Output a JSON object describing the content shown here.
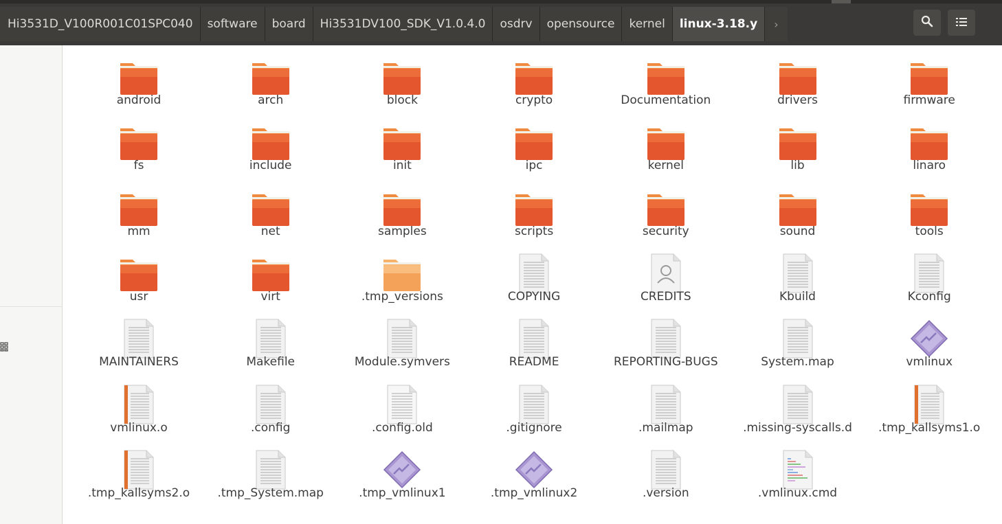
{
  "breadcrumb": [
    "Hi3531D_V100R001C01SPC040",
    "software",
    "board",
    "Hi3531DV100_SDK_V1.0.4.0",
    "osdrv",
    "opensource",
    "kernel",
    "linux-3.18.y"
  ],
  "more_glyph": "›",
  "toolbar": {
    "search_glyph": "🔍",
    "list_glyph": "☷",
    "grid_glyph": "⋮⋮"
  },
  "colors": {
    "folder": "#e4562e",
    "folder_light": "#f08a3e",
    "header_bg": "#3a3937",
    "exec": "#9b87c8"
  },
  "files": [
    {
      "name": "android",
      "kind": "folder"
    },
    {
      "name": "arch",
      "kind": "folder"
    },
    {
      "name": "block",
      "kind": "folder"
    },
    {
      "name": "crypto",
      "kind": "folder"
    },
    {
      "name": "Documentation",
      "kind": "folder"
    },
    {
      "name": "drivers",
      "kind": "folder"
    },
    {
      "name": "firmware",
      "kind": "folder"
    },
    {
      "name": "fs",
      "kind": "folder"
    },
    {
      "name": "include",
      "kind": "folder"
    },
    {
      "name": "init",
      "kind": "folder"
    },
    {
      "name": "ipc",
      "kind": "folder"
    },
    {
      "name": "kernel",
      "kind": "folder"
    },
    {
      "name": "lib",
      "kind": "folder"
    },
    {
      "name": "linaro",
      "kind": "folder"
    },
    {
      "name": "mm",
      "kind": "folder"
    },
    {
      "name": "net",
      "kind": "folder"
    },
    {
      "name": "samples",
      "kind": "folder"
    },
    {
      "name": "scripts",
      "kind": "folder"
    },
    {
      "name": "security",
      "kind": "folder"
    },
    {
      "name": "sound",
      "kind": "folder"
    },
    {
      "name": "tools",
      "kind": "folder"
    },
    {
      "name": "usr",
      "kind": "folder"
    },
    {
      "name": "virt",
      "kind": "folder"
    },
    {
      "name": ".tmp_versions",
      "kind": "folder-hidden"
    },
    {
      "name": "COPYING",
      "kind": "text"
    },
    {
      "name": "CREDITS",
      "kind": "contact"
    },
    {
      "name": "Kbuild",
      "kind": "text"
    },
    {
      "name": "Kconfig",
      "kind": "text"
    },
    {
      "name": "MAINTAINERS",
      "kind": "text"
    },
    {
      "name": "Makefile",
      "kind": "text"
    },
    {
      "name": "Module.symvers",
      "kind": "text"
    },
    {
      "name": "README",
      "kind": "text"
    },
    {
      "name": "REPORTING-BUGS",
      "kind": "text"
    },
    {
      "name": "System.map",
      "kind": "text"
    },
    {
      "name": "vmlinux",
      "kind": "exec"
    },
    {
      "name": "vmlinux.o",
      "kind": "object"
    },
    {
      "name": ".config",
      "kind": "text"
    },
    {
      "name": ".config.old",
      "kind": "text-hidden"
    },
    {
      "name": ".gitignore",
      "kind": "text"
    },
    {
      "name": ".mailmap",
      "kind": "text"
    },
    {
      "name": ".missing-syscalls.d",
      "kind": "text"
    },
    {
      "name": ".tmp_kallsyms1.o",
      "kind": "object"
    },
    {
      "name": ".tmp_kallsyms2.o",
      "kind": "object"
    },
    {
      "name": ".tmp_System.map",
      "kind": "text"
    },
    {
      "name": ".tmp_vmlinux1",
      "kind": "exec"
    },
    {
      "name": ".tmp_vmlinux2",
      "kind": "exec"
    },
    {
      "name": ".version",
      "kind": "text"
    },
    {
      "name": ".vmlinux.cmd",
      "kind": "script"
    }
  ]
}
